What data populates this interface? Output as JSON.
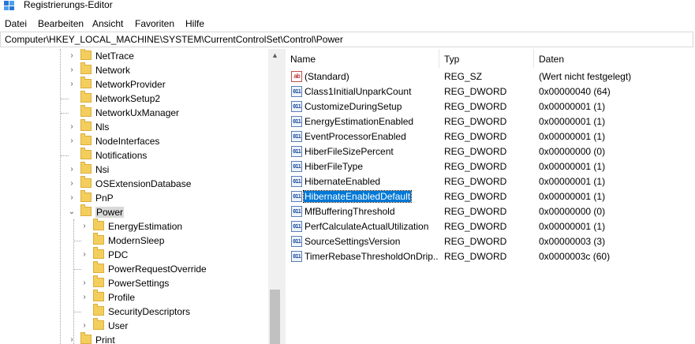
{
  "window": {
    "title": "Registrierungs-Editor",
    "icon": "registry-editor-icon"
  },
  "menu": [
    "Datei",
    "Bearbeiten",
    "Ansicht",
    "Favoriten",
    "Hilfe"
  ],
  "address": "Computer\\HKEY_LOCAL_MACHINE\\SYSTEM\\CurrentControlSet\\Control\\Power",
  "tree": {
    "items": [
      {
        "label": "NetTrace",
        "level": 1,
        "expandable": true
      },
      {
        "label": "Network",
        "level": 1,
        "expandable": true
      },
      {
        "label": "NetworkProvider",
        "level": 1,
        "expandable": true
      },
      {
        "label": "NetworkSetup2",
        "level": 1,
        "expandable": false
      },
      {
        "label": "NetworkUxManager",
        "level": 1,
        "expandable": false
      },
      {
        "label": "Nls",
        "level": 1,
        "expandable": true
      },
      {
        "label": "NodeInterfaces",
        "level": 1,
        "expandable": true
      },
      {
        "label": "Notifications",
        "level": 1,
        "expandable": false
      },
      {
        "label": "Nsi",
        "level": 1,
        "expandable": true
      },
      {
        "label": "OSExtensionDatabase",
        "level": 1,
        "expandable": true
      },
      {
        "label": "PnP",
        "level": 1,
        "expandable": true
      },
      {
        "label": "Power",
        "level": 1,
        "expandable": true,
        "expanded": true,
        "selected": true
      },
      {
        "label": "EnergyEstimation",
        "level": 2,
        "expandable": true
      },
      {
        "label": "ModernSleep",
        "level": 2,
        "expandable": false
      },
      {
        "label": "PDC",
        "level": 2,
        "expandable": true
      },
      {
        "label": "PowerRequestOverride",
        "level": 2,
        "expandable": false
      },
      {
        "label": "PowerSettings",
        "level": 2,
        "expandable": true
      },
      {
        "label": "Profile",
        "level": 2,
        "expandable": true
      },
      {
        "label": "SecurityDescriptors",
        "level": 2,
        "expandable": false
      },
      {
        "label": "User",
        "level": 2,
        "expandable": true
      },
      {
        "label": "Print",
        "level": 1,
        "expandable": true
      }
    ]
  },
  "list": {
    "headers": {
      "name": "Name",
      "type": "Typ",
      "data": "Daten"
    },
    "rows": [
      {
        "name": "(Standard)",
        "type": "REG_SZ",
        "data": "(Wert nicht festgelegt)",
        "icon": "string-value-icon"
      },
      {
        "name": "Class1InitialUnparkCount",
        "type": "REG_DWORD",
        "data": "0x00000040 (64)",
        "icon": "binary-value-icon"
      },
      {
        "name": "CustomizeDuringSetup",
        "type": "REG_DWORD",
        "data": "0x00000001 (1)",
        "icon": "binary-value-icon"
      },
      {
        "name": "EnergyEstimationEnabled",
        "type": "REG_DWORD",
        "data": "0x00000001 (1)",
        "icon": "binary-value-icon"
      },
      {
        "name": "EventProcessorEnabled",
        "type": "REG_DWORD",
        "data": "0x00000001 (1)",
        "icon": "binary-value-icon"
      },
      {
        "name": "HiberFileSizePercent",
        "type": "REG_DWORD",
        "data": "0x00000000 (0)",
        "icon": "binary-value-icon"
      },
      {
        "name": "HiberFileType",
        "type": "REG_DWORD",
        "data": "0x00000001 (1)",
        "icon": "binary-value-icon"
      },
      {
        "name": "HibernateEnabled",
        "type": "REG_DWORD",
        "data": "0x00000001 (1)",
        "icon": "binary-value-icon"
      },
      {
        "name": "HibernateEnabledDefault",
        "type": "REG_DWORD",
        "data": "0x00000001 (1)",
        "icon": "binary-value-icon",
        "selected": true
      },
      {
        "name": "MfBufferingThreshold",
        "type": "REG_DWORD",
        "data": "0x00000000 (0)",
        "icon": "binary-value-icon"
      },
      {
        "name": "PerfCalculateActualUtilization",
        "type": "REG_DWORD",
        "data": "0x00000001 (1)",
        "icon": "binary-value-icon"
      },
      {
        "name": "SourceSettingsVersion",
        "type": "REG_DWORD",
        "data": "0x00000003 (3)",
        "icon": "binary-value-icon"
      },
      {
        "name": "TimerRebaseThresholdOnDrip...",
        "type": "REG_DWORD",
        "data": "0x0000003c (60)",
        "icon": "binary-value-icon"
      }
    ]
  },
  "colors": {
    "selection": "#0078d7",
    "tree_selection": "#d9d9d9",
    "folder": "#f4ce5d"
  }
}
